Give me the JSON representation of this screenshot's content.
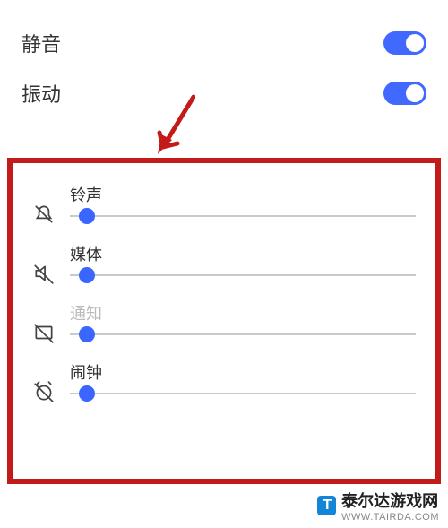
{
  "toggles": {
    "mute": {
      "label": "静音",
      "on": true
    },
    "vibrate": {
      "label": "振动",
      "on": true
    }
  },
  "sliders": {
    "ringtone": {
      "label": "铃声",
      "value": 5,
      "disabled": false
    },
    "media": {
      "label": "媒体",
      "value": 5,
      "disabled": false
    },
    "notify": {
      "label": "通知",
      "value": 5,
      "disabled": true
    },
    "alarm": {
      "label": "闹钟",
      "value": 5,
      "disabled": false
    }
  },
  "annotation": {
    "highlight_color": "#c31a1a",
    "arrow_color": "#c31a1a"
  },
  "watermark": {
    "badge": "T",
    "text": "泰尔达游戏网",
    "url": "WWW.TAIRDA.COM"
  }
}
